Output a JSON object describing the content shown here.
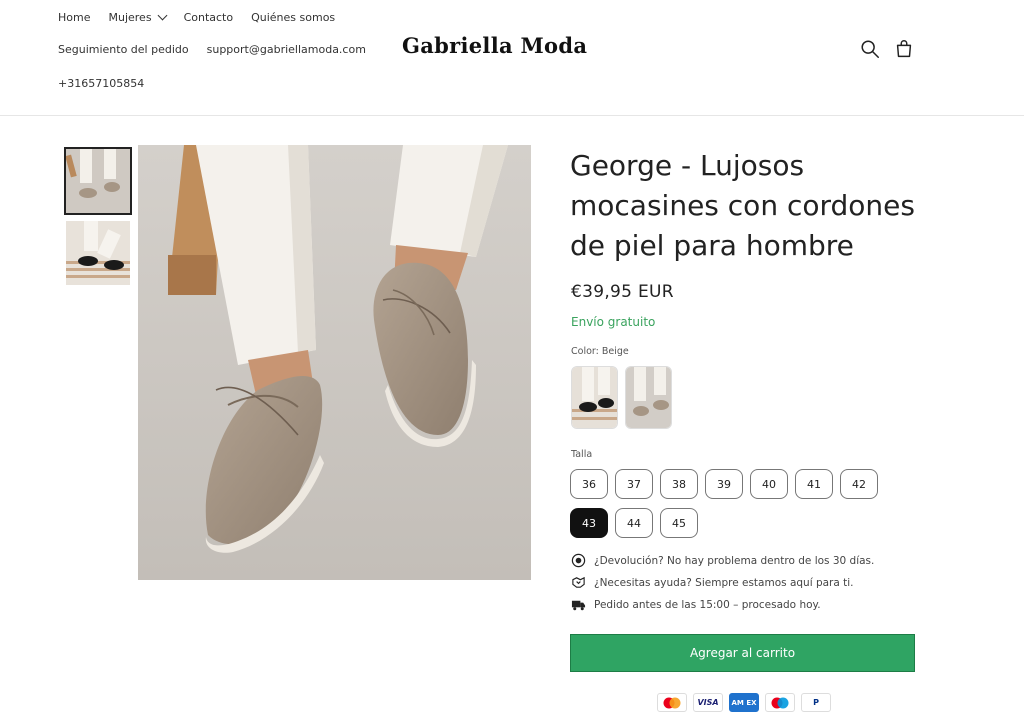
{
  "header": {
    "nav": [
      "Home",
      "Mujeres",
      "Contacto",
      "Quiénes somos"
    ],
    "nav2": [
      "Seguimiento del pedido",
      "support@gabriellamoda.com"
    ],
    "phone": "+31657105854",
    "logo": "Gabriella Moda",
    "icons": [
      "search-icon",
      "cart-icon"
    ]
  },
  "product": {
    "title": "George - Lujosos mocasines con cordones de piel para hombre",
    "price": "€39,95 EUR",
    "shipping": "Envío gratuito",
    "color_label": "Color: Beige",
    "size_label": "Talla",
    "sizes": [
      "36",
      "37",
      "38",
      "39",
      "40",
      "41",
      "42",
      "43",
      "44",
      "45"
    ],
    "selected_size": "43",
    "info": [
      "¿Devolución? No hay problema dentro de los 30 días.",
      "¿Necesitas ayuda? Siempre estamos aquí para ti.",
      "Pedido antes de las 15:00 – procesado hoy."
    ],
    "add_to_cart": "Agregar al carrito"
  },
  "payments": [
    "Mastercard",
    "VISA",
    "AMEX",
    "Maestro",
    "PayPal"
  ],
  "colors": {
    "accent_green": "#2fa463",
    "shipping_green": "#3aa35e",
    "selected_size": "#111111"
  }
}
